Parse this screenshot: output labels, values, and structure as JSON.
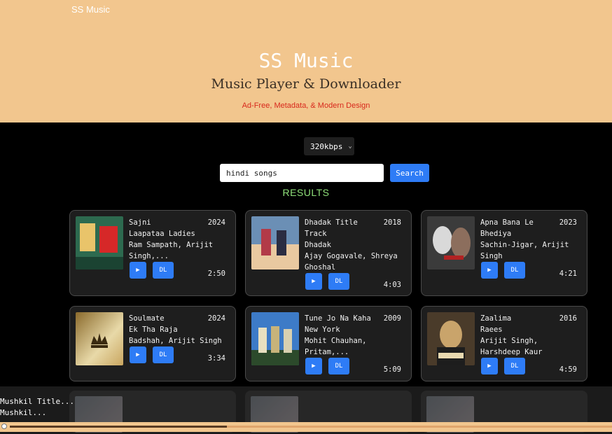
{
  "header": {
    "brand": "SS Music",
    "title": "SS Music",
    "subtitle": "Music Player & Downloader",
    "tagline": "Ad-Free, Metadata, & Modern Design"
  },
  "controls": {
    "quality": "320kbps",
    "search_value": "hindi songs",
    "search_button": "Search",
    "results_heading": "RESULTS"
  },
  "buttons": {
    "play": "▶",
    "download": "DL"
  },
  "results": [
    {
      "lines": [
        "Sajni",
        "Laapataa Ladies",
        "Ram Sampath, Arijit",
        "Singh,..."
      ],
      "year": "2024",
      "duration": "2:50",
      "cover_colors": [
        "#2d6a4f",
        "#e9c46a",
        "#d62828"
      ]
    },
    {
      "lines": [
        "Dhadak Title",
        "Track",
        "Dhadak",
        "Ajay Gogavale, Shreya",
        "Ghoshal"
      ],
      "year": "2018",
      "duration": "4:03",
      "cover_colors": [
        "#6b8fb5",
        "#e9c9a0",
        "#b23a48"
      ]
    },
    {
      "lines": [
        "Apna Bana Le",
        "Bhediya",
        "Sachin-Jigar, Arijit",
        "Singh"
      ],
      "year": "2023",
      "duration": "4:21",
      "cover_colors": [
        "#3b3b3b",
        "#d9d9d9",
        "#b22222"
      ]
    },
    {
      "lines": [
        "Soulmate",
        "Ek Tha Raja",
        "Badshah, Arijit Singh"
      ],
      "year": "2024",
      "duration": "3:34",
      "cover_colors": [
        "#8a6a2c",
        "#e8d9a8",
        "#3a2a10"
      ]
    },
    {
      "lines": [
        "Tune Jo Na Kaha",
        "New York",
        "Mohit Chauhan,",
        "Pritam,..."
      ],
      "year": "2009",
      "duration": "5:09",
      "cover_colors": [
        "#3d7bc7",
        "#e8e0c0",
        "#2c4a2b"
      ]
    },
    {
      "lines": [
        "Zaalima",
        "Raees",
        "Arijit Singh,",
        "Harshdeep Kaur"
      ],
      "year": "2016",
      "duration": "4:59",
      "cover_colors": [
        "#4a3b2a",
        "#c9a46b",
        "#1d1d1d"
      ]
    }
  ],
  "now_playing": {
    "title": "Mushkil Title...",
    "artist": "Mushkil...",
    "progress": 0.36
  }
}
